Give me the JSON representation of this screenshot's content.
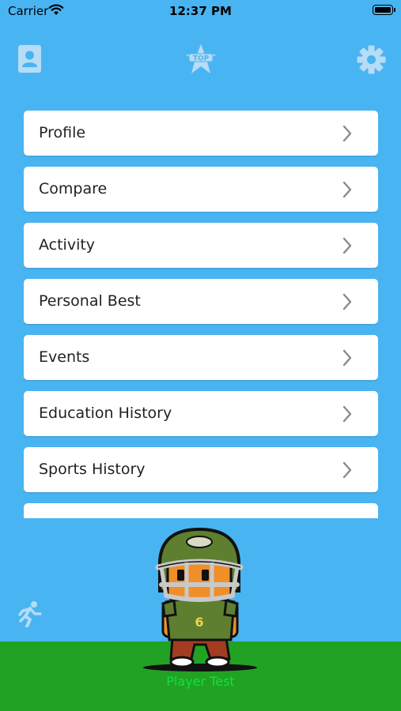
{
  "status_bar": {
    "carrier": "Carrier",
    "time": "12:37 PM"
  },
  "header": {
    "left_icon": "contact-card-icon",
    "center_icon": "top-logo-icon",
    "center_logo_text": "TOP",
    "right_icon": "gear-icon"
  },
  "menu": {
    "items": [
      {
        "label": "Profile"
      },
      {
        "label": "Compare"
      },
      {
        "label": "Activity"
      },
      {
        "label": "Personal Best"
      },
      {
        "label": "Events"
      },
      {
        "label": "Education History"
      },
      {
        "label": "Sports History"
      },
      {
        "label": ""
      }
    ]
  },
  "footer": {
    "left_icon": "running-person-icon",
    "avatar_jersey_number": "6",
    "player_name": "Player Test"
  },
  "colors": {
    "background": "#49b4f2",
    "grass": "#21a224",
    "player_name": "#0ee33a",
    "icon": "#b6dcf6"
  }
}
